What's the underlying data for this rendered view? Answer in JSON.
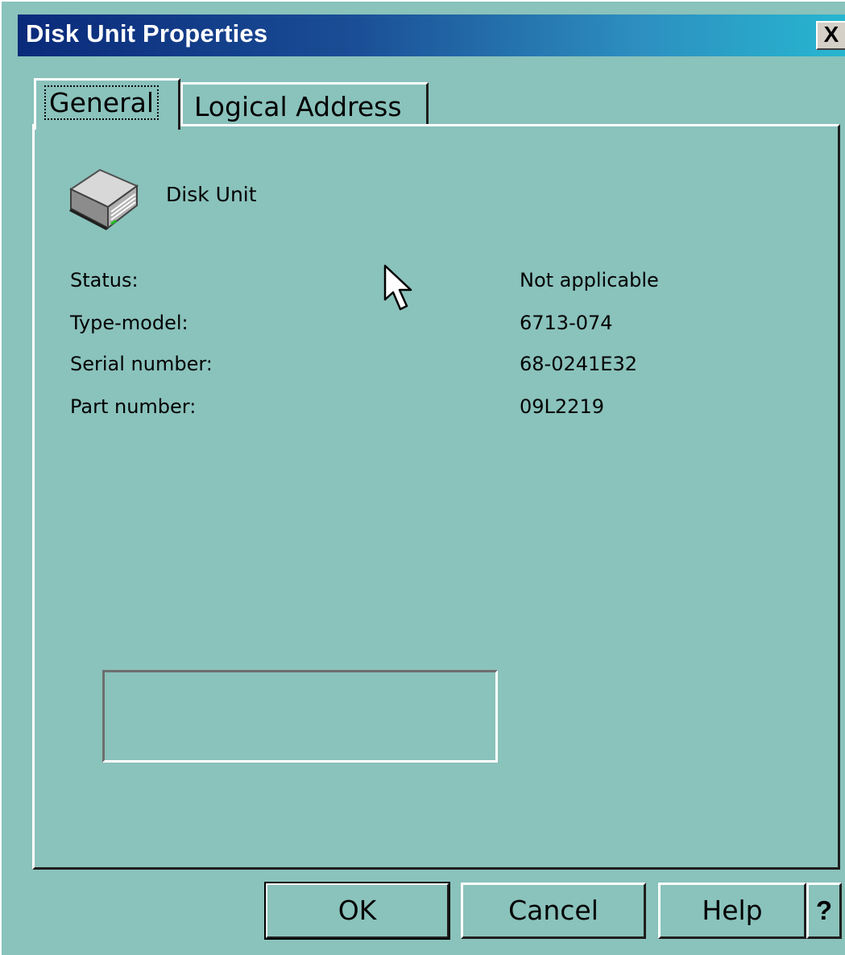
{
  "window": {
    "title": "Disk Unit Properties",
    "close_label": "X"
  },
  "tabs": [
    {
      "label": "General",
      "selected": true
    },
    {
      "label": "Logical Address",
      "selected": false
    }
  ],
  "general": {
    "icon": "disk-unit-icon",
    "heading": "Disk Unit",
    "fields": {
      "status": {
        "label": "Status:",
        "value": "Not applicable"
      },
      "type_model": {
        "label": "Type-model:",
        "value": "6713-074"
      },
      "serial_number": {
        "label": "Serial number:",
        "value": "68-0241E32"
      },
      "part_number": {
        "label": "Part number:",
        "value": "09L2219"
      }
    }
  },
  "buttons": {
    "ok": "OK",
    "cancel": "Cancel",
    "help": "Help",
    "whats_this": "?"
  },
  "colors": {
    "background": "#8ac2bc",
    "titlebar_start": "#0a2a7a",
    "titlebar_end": "#27b6d0"
  }
}
